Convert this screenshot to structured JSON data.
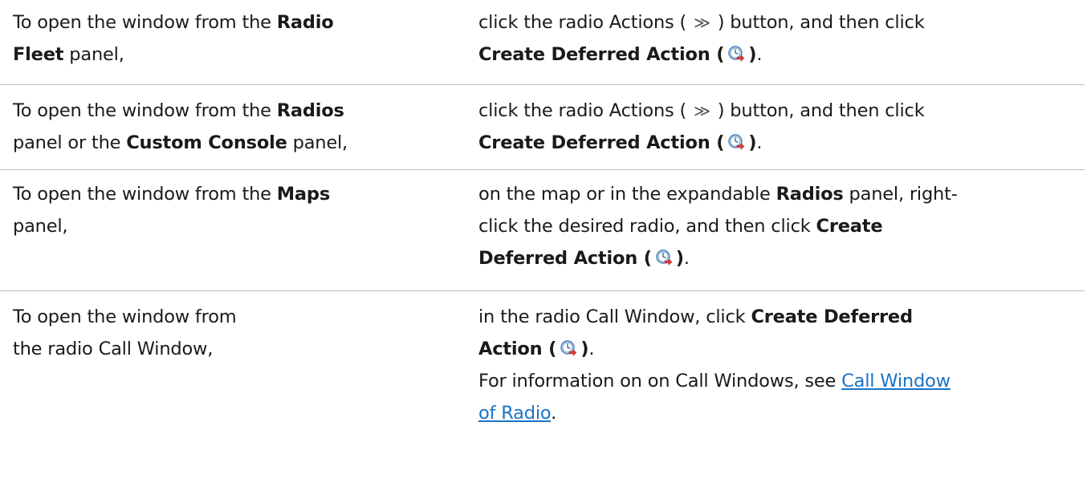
{
  "rows": [
    {
      "left": {
        "l1_pre": "To open the window from the ",
        "l1_bold": "Radio",
        "l2_bold": "Fleet",
        "l2_post": " panel,"
      },
      "right": {
        "l1_pre": "click the radio Actions (",
        "l1_sym": "≫",
        "l1_post": ") button, and then click",
        "l2_bold": "Create Deferred Action (",
        "l2_close": ")",
        "l2_dot": "."
      }
    },
    {
      "left": {
        "l1_pre": "To open the window from the ",
        "l1_bold": "Radios",
        "l2_pre": "panel or the ",
        "l2_bold": "Custom Console",
        "l2_post": " panel,"
      },
      "right": {
        "l1_pre": "click the radio Actions (",
        "l1_sym": "≫",
        "l1_post": ") button, and then click",
        "l2_bold": "Create Deferred Action (",
        "l2_close": ")",
        "l2_dot": "."
      }
    },
    {
      "left": {
        "l1_pre": "To open the window from the ",
        "l1_bold": "Maps",
        "l2": "panel,"
      },
      "right": {
        "l1_pre": "on the map or in the expandable ",
        "l1_bold": "Radios",
        "l1_post": " panel, right-",
        "l2_pre": "click the desired radio, and then click ",
        "l2_bold": "Create",
        "l3_bold": "Deferred Action (",
        "l3_close": ")",
        "l3_dot": "."
      }
    },
    {
      "left": {
        "l1": "To open the window from",
        "l2": "the radio Call Window,"
      },
      "right": {
        "l1_pre": "in the radio Call Window, click ",
        "l1_bold": "Create Deferred",
        "l2_bold": "Action (",
        "l2_close": ")",
        "l2_dot": ".",
        "l3_pre": "For information on on Call Windows, see ",
        "l3_link": "Call Window",
        "l4_link": "of Radio",
        "l4_dot": "."
      }
    }
  ],
  "icon": "deferred-action-icon"
}
